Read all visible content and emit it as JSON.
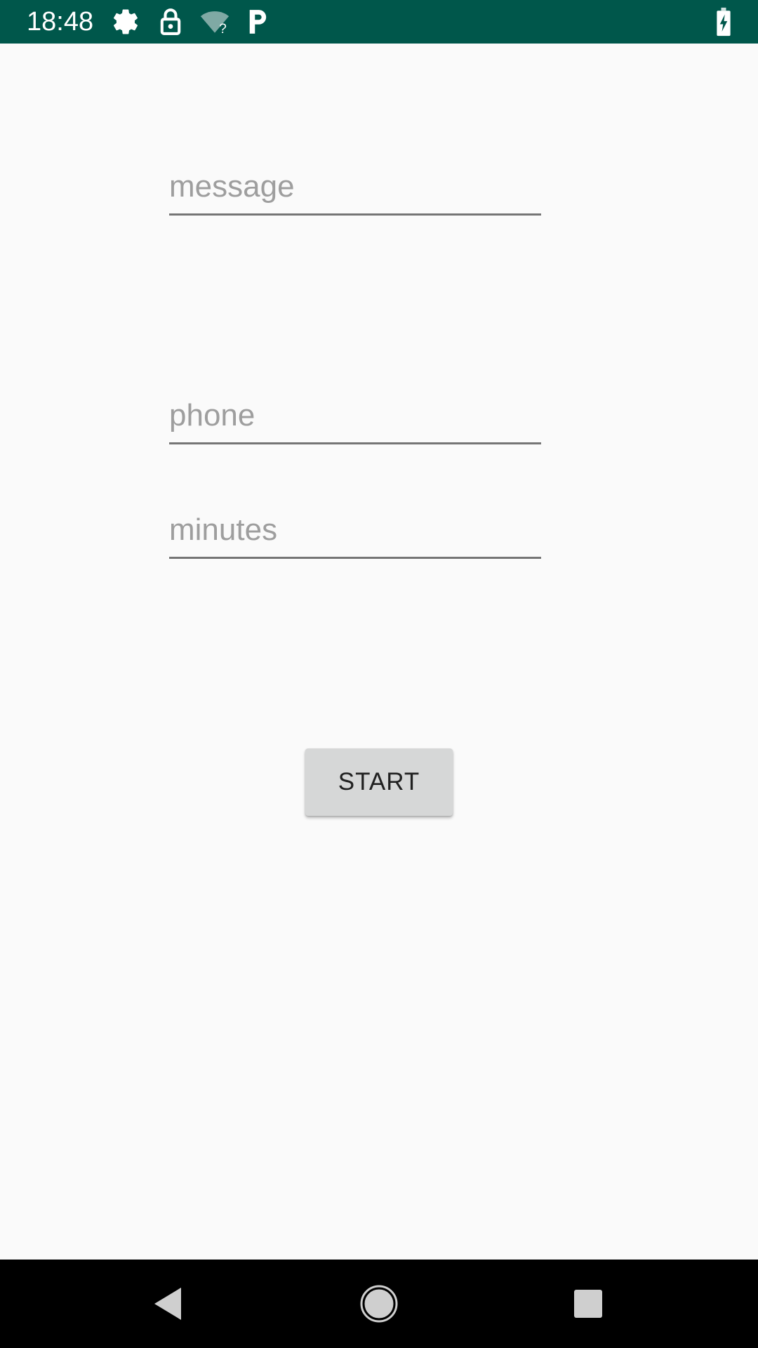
{
  "status_bar": {
    "time": "18:48",
    "icons": [
      "settings-icon",
      "lock-icon",
      "wifi-unknown-icon",
      "parking-icon",
      "battery-charging-icon"
    ],
    "background_color": "#00574b"
  },
  "form": {
    "message_placeholder": "message",
    "message_value": "",
    "phone_placeholder": "phone",
    "phone_value": "",
    "minutes_placeholder": "minutes",
    "minutes_value": ""
  },
  "start_button": {
    "label": "START"
  },
  "nav_bar": {
    "buttons": [
      "back-icon",
      "home-icon",
      "recents-icon"
    ]
  }
}
